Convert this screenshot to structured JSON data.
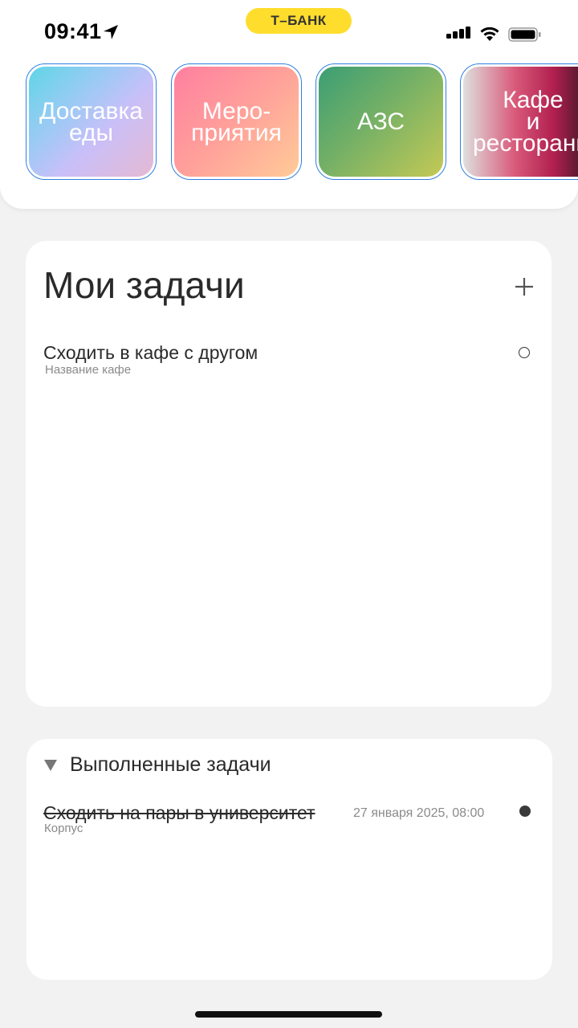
{
  "status_bar": {
    "time": "09:41",
    "brand": "Т–БАНК",
    "brand_color": "#ffdd2d"
  },
  "stories": [
    {
      "label": "Доставка\nеды"
    },
    {
      "label": "Меро-\nприятия"
    },
    {
      "label": "АЗС"
    },
    {
      "label": "Кафе\nи\nрестораны"
    }
  ],
  "tasks": {
    "title": "Мои задачи",
    "add_icon": "plus-icon",
    "items": [
      {
        "title": "Сходить в кафе с другом",
        "subtitle": "Название кафе",
        "done": false
      }
    ]
  },
  "completed": {
    "title": "Выполненные задачи",
    "items": [
      {
        "title": "Сходить на пары в университет",
        "date": "27 января 2025, 08:00",
        "subtitle": "Корпус",
        "done": true
      }
    ]
  },
  "colors": {
    "accent_border": "#2f7fe0",
    "background": "#f2f2f2"
  }
}
